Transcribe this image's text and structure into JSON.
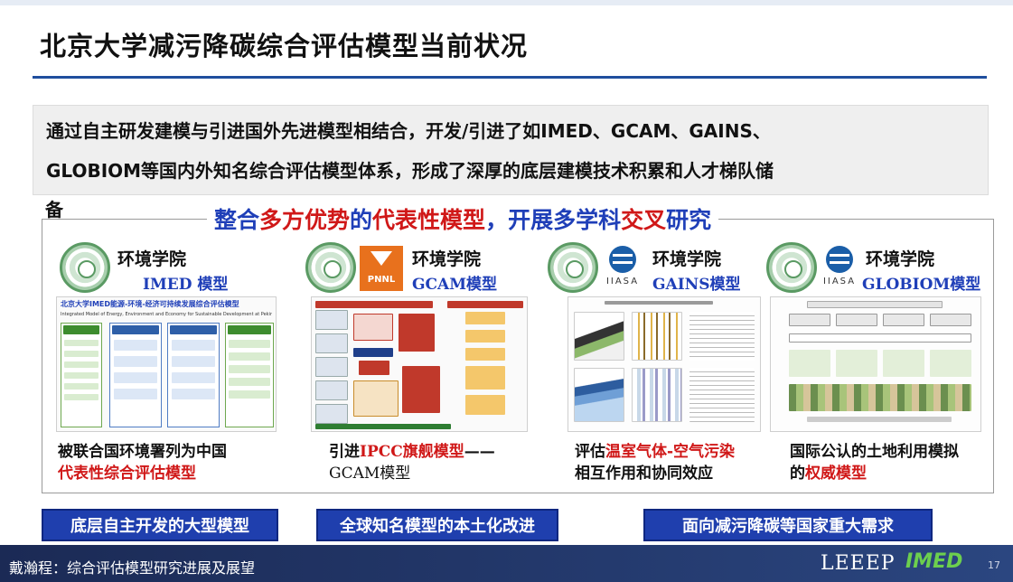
{
  "slide": {
    "title": "北京大学减污降碳综合评估模型当前状况",
    "intro_line1": "通过自主研发建模与引进国外先进模型相结合，开发/引进了如IMED、GCAM、GAINS、",
    "intro_line2": "GLOBIOM等国内外知名综合评估模型体系，形成了深厚的底层建模技术积累和人才梯队储",
    "intro_line3": "备",
    "headline": {
      "part1": "整合",
      "part2": "多方优势",
      "part3": "的",
      "part4": "代表性模型",
      "part5": "，开展",
      "part6": "多学科",
      "part7": "交叉",
      "part8": "研究"
    }
  },
  "panels": [
    {
      "institution": "环境学院",
      "model_name": "IMED 模型",
      "screenshot_title": "北京大学IMED能源-环境-经济可持续发展综合评估模型",
      "screenshot_subtitle": "Integrated Model of Energy, Environment and Economy for Sustainable Development at Peking University",
      "caption_line1": "被联合国环境署列为中国",
      "caption_line2": "代表性综合评估模型"
    },
    {
      "institution": "环境学院",
      "model_name": "GCAM模型",
      "logo_text": "PNNL",
      "caption_prefix": "引进",
      "caption_highlight": "IPCC旗舰模型",
      "caption_suffix": "——",
      "caption_line2": "GCAM模型"
    },
    {
      "institution": "环境学院",
      "model_name": "GAINS模型",
      "logo_text": "IIASA",
      "caption_prefix": "评估",
      "caption_highlight": "温室气体-空气污染",
      "caption_line2": "相互作用和协同效应"
    },
    {
      "institution": "环境学院",
      "model_name": "GLOBIOM模型",
      "logo_text": "IIASA",
      "caption_line1": "国际公认的土地利用模拟",
      "caption_prefix2": "的",
      "caption_highlight2": "权威模型"
    }
  ],
  "bottom_buttons": [
    {
      "label": "底层自主开发的大型模型"
    },
    {
      "label": "全球知名模型的本土化改进"
    },
    {
      "label": "面向减污降碳等国家重大需求"
    }
  ],
  "footer": {
    "presenter": "戴瀚程：综合评估模型研究进展及展望",
    "brand1": "LEEEP",
    "brand2": "IMED",
    "page": "17"
  },
  "colors": {
    "accent_blue": "#1f3fb8",
    "accent_red": "#d01818",
    "button_blue": "#1f3fae",
    "footer_navy": "#1b2a55",
    "pnnl_orange": "#e8711d"
  }
}
